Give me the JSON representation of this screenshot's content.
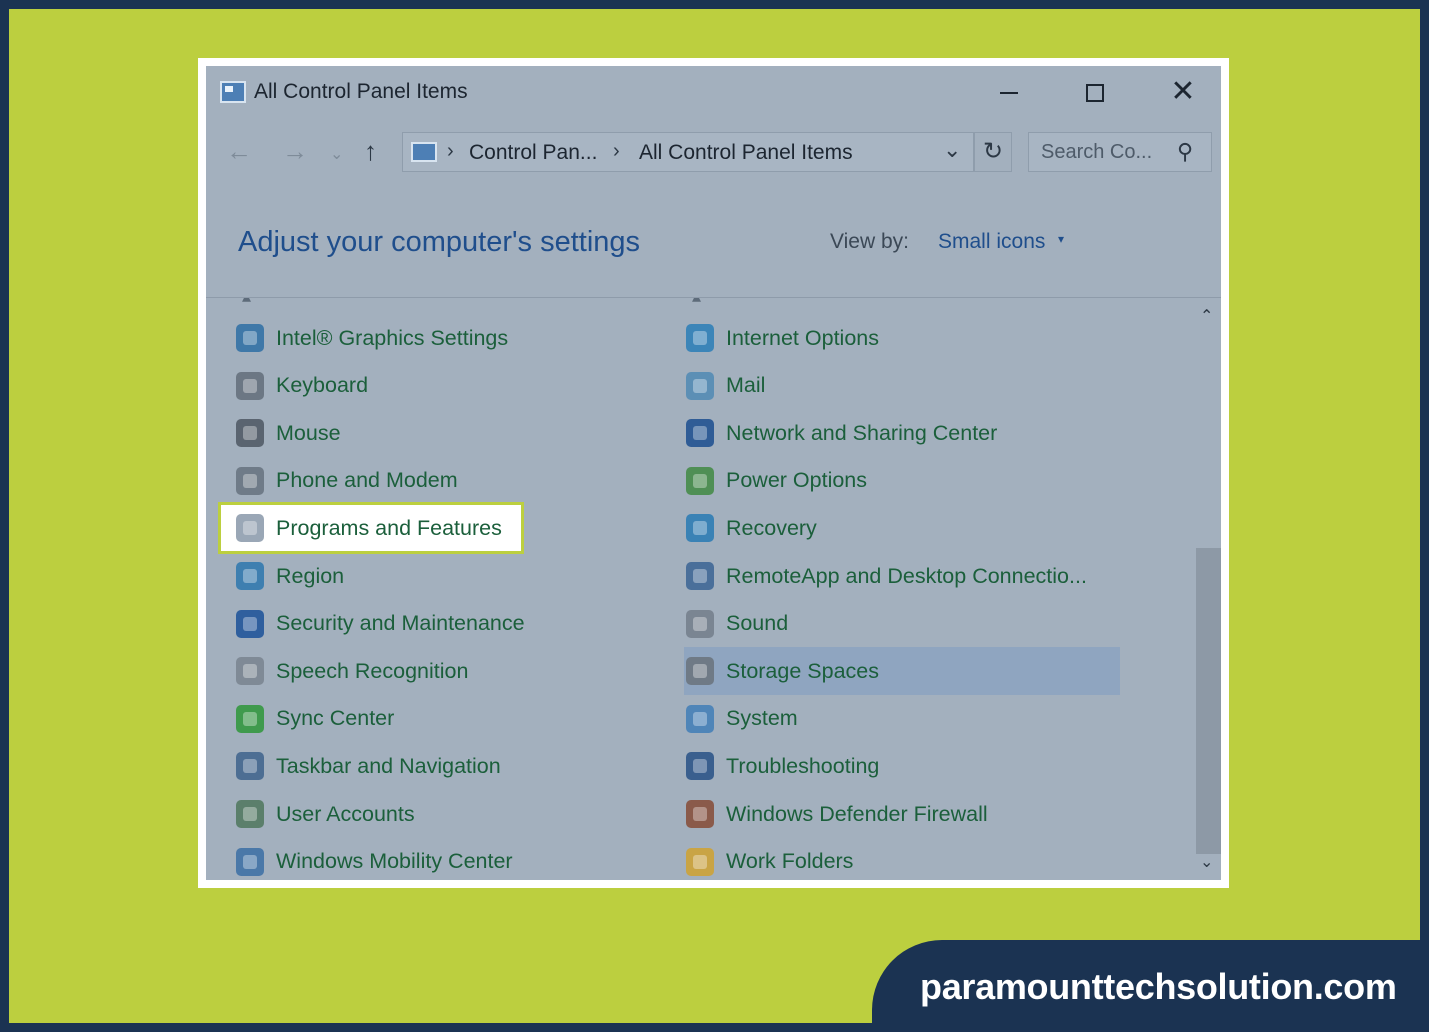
{
  "window": {
    "title": "All Control Panel Items",
    "minimize": "",
    "maximize": "",
    "close": "✕"
  },
  "nav": {
    "back": "←",
    "forward": "→",
    "recent": "⌄",
    "up": "↑",
    "breadcrumb": [
      "Control Pan...",
      "All Control Panel Items"
    ],
    "separator": "›",
    "dropdown": "⌄",
    "refresh": "↻",
    "search_placeholder": "Search Co...",
    "search_icon": "⚲"
  },
  "header": {
    "title": "Adjust your computer's settings",
    "view_by_label": "View by:",
    "view_by_value": "Small icons",
    "view_by_caret": "▾"
  },
  "items_left": [
    {
      "label": "Intel® Graphics Settings",
      "icon": "intel-graphics-icon",
      "color": "#3f78a8"
    },
    {
      "label": "Keyboard",
      "icon": "keyboard-icon",
      "color": "#6c7784"
    },
    {
      "label": "Mouse",
      "icon": "mouse-icon",
      "color": "#5a6470"
    },
    {
      "label": "Phone and Modem",
      "icon": "phone-modem-icon",
      "color": "#6f7b88"
    },
    {
      "label": "Programs and Features",
      "icon": "programs-features-icon",
      "color": "#9aa7b6"
    },
    {
      "label": "Region",
      "icon": "region-globe-icon",
      "color": "#3e7fb0"
    },
    {
      "label": "Security and Maintenance",
      "icon": "flag-icon",
      "color": "#2f5f9e"
    },
    {
      "label": "Speech Recognition",
      "icon": "microphone-icon",
      "color": "#7f8a96"
    },
    {
      "label": "Sync Center",
      "icon": "sync-icon",
      "color": "#3f9a4d"
    },
    {
      "label": "Taskbar and Navigation",
      "icon": "taskbar-icon",
      "color": "#4d6e93"
    },
    {
      "label": "User Accounts",
      "icon": "users-icon",
      "color": "#5b7f6b"
    },
    {
      "label": "Windows Mobility Center",
      "icon": "mobility-icon",
      "color": "#4a78a8"
    }
  ],
  "items_right": [
    {
      "label": "Internet Options",
      "icon": "internet-options-icon",
      "color": "#3c85b8"
    },
    {
      "label": "Mail",
      "icon": "mail-icon",
      "color": "#5c8fb5"
    },
    {
      "label": "Network and Sharing Center",
      "icon": "network-icon",
      "color": "#2f5c96"
    },
    {
      "label": "Power Options",
      "icon": "power-icon",
      "color": "#4f8f55"
    },
    {
      "label": "Recovery",
      "icon": "recovery-icon",
      "color": "#3a82b5"
    },
    {
      "label": "RemoteApp and Desktop Connectio...",
      "icon": "remoteapp-icon",
      "color": "#4a6f9a"
    },
    {
      "label": "Sound",
      "icon": "speaker-icon",
      "color": "#7a8592"
    },
    {
      "label": "Storage Spaces",
      "icon": "storage-icon",
      "color": "#6f7a86"
    },
    {
      "label": "System",
      "icon": "system-icon",
      "color": "#4f85b8"
    },
    {
      "label": "Troubleshooting",
      "icon": "troubleshooting-icon",
      "color": "#3a5f8e"
    },
    {
      "label": "Windows Defender Firewall",
      "icon": "firewall-icon",
      "color": "#8a5a4a"
    },
    {
      "label": "Work Folders",
      "icon": "work-folders-icon",
      "color": "#c9a445"
    }
  ],
  "scroll": {
    "up": "⌃",
    "down": "⌄"
  },
  "brand": {
    "text": "paramounttechsolution.com"
  }
}
